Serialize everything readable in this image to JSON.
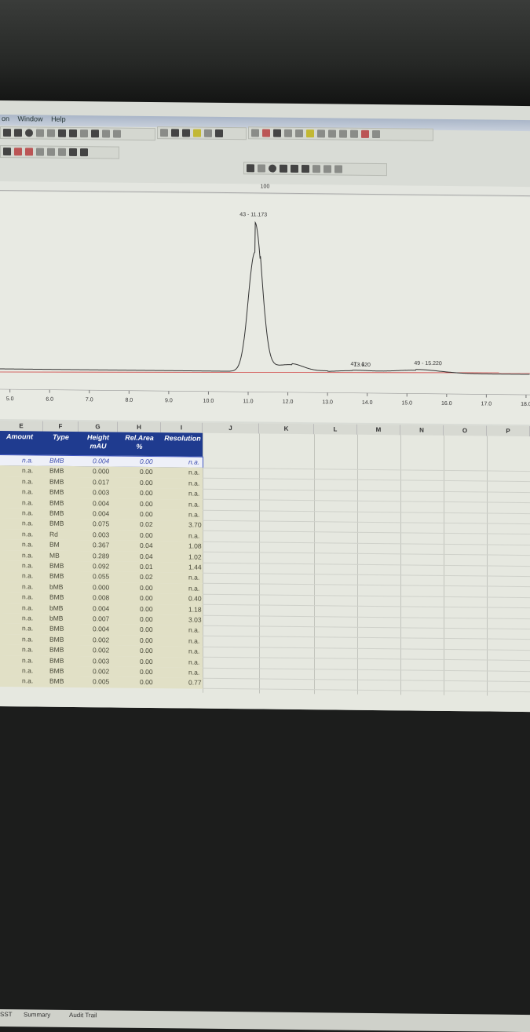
{
  "menu": [
    "on",
    "Window",
    "Help"
  ],
  "ruler_label": "100",
  "chart_data": {
    "type": "line",
    "xlabel": "",
    "ylabel": "",
    "xlim": [
      4.75,
      18.1
    ],
    "ticks": [
      "5.0",
      "6.0",
      "7.0",
      "8.0",
      "9.0",
      "10.0",
      "11.0",
      "12.0",
      "13.0",
      "14.0",
      "15.0",
      "16.0",
      "17.0",
      "18.0"
    ],
    "tick_values": [
      5,
      6,
      7,
      8,
      9,
      10,
      11,
      12,
      13,
      14,
      15,
      16,
      17,
      18
    ],
    "peaks": [
      {
        "rt": 11.173,
        "height": 100,
        "width": 0.17,
        "label": "43 - 11.173"
      },
      {
        "rt": 12.1,
        "height": 4,
        "width": 0.3,
        "label": ""
      },
      {
        "rt": 13.62,
        "height": 1.5,
        "width": 0.5,
        "label": "47 - 1"
      },
      {
        "rt": 15.22,
        "height": 2.5,
        "width": 0.6,
        "label": "49 - 15.220"
      }
    ],
    "extra_labels": [
      "13.620"
    ],
    "baseline_color": "#d04040",
    "trace_color": "#333333"
  },
  "columns": [
    "E",
    "F",
    "G",
    "H",
    "I",
    "J",
    "K",
    "L",
    "M",
    "N",
    "O",
    "P"
  ],
  "headers": {
    "amount": "Amount",
    "type": "Type",
    "height": "Height",
    "height_unit": "mAU",
    "relarea": "Rel.Area",
    "relarea_unit": "%",
    "resolution": "Resolution"
  },
  "rows": [
    [
      "n.a.",
      "BMB",
      "0.004",
      "0.00",
      "n.a."
    ],
    [
      "n.a.",
      "BMB",
      "0.000",
      "0.00",
      "n.a."
    ],
    [
      "n.a.",
      "BMB",
      "0.017",
      "0.00",
      "n.a."
    ],
    [
      "n.a.",
      "BMB",
      "0.003",
      "0.00",
      "n.a."
    ],
    [
      "n.a.",
      "BMB",
      "0.004",
      "0.00",
      "n.a."
    ],
    [
      "n.a.",
      "BMB",
      "0.004",
      "0.00",
      "n.a."
    ],
    [
      "n.a.",
      "BMB",
      "0.075",
      "0.02",
      "3.70"
    ],
    [
      "n.a.",
      "Rd",
      "0.003",
      "0.00",
      "n.a."
    ],
    [
      "n.a.",
      "BM",
      "0.367",
      "0.04",
      "1.08"
    ],
    [
      "n.a.",
      "MB",
      "0.289",
      "0.04",
      "1.02"
    ],
    [
      "n.a.",
      "BMB",
      "0.092",
      "0.01",
      "1.44"
    ],
    [
      "n.a.",
      "BMB",
      "0.055",
      "0.02",
      "n.a."
    ],
    [
      "n.a.",
      "bMB",
      "0.000",
      "0.00",
      "n.a."
    ],
    [
      "n.a.",
      "BMB",
      "0.008",
      "0.00",
      "0.40"
    ],
    [
      "n.a.",
      "bMB",
      "0.004",
      "0.00",
      "1.18"
    ],
    [
      "n.a.",
      "bMB",
      "0.007",
      "0.00",
      "3.03"
    ],
    [
      "n.a.",
      "BMB",
      "0.004",
      "0.00",
      "n.a."
    ],
    [
      "n.a.",
      "BMB",
      "0.002",
      "0.00",
      "n.a."
    ],
    [
      "n.a.",
      "BMB",
      "0.002",
      "0.00",
      "n.a."
    ],
    [
      "n.a.",
      "BMB",
      "0.003",
      "0.00",
      "n.a."
    ],
    [
      "n.a.",
      "BMB",
      "0.002",
      "0.00",
      "n.a."
    ],
    [
      "n.a.",
      "BMB",
      "0.005",
      "0.00",
      "0.77"
    ]
  ],
  "tabs": [
    "SST",
    "Summary",
    "Audit Trail"
  ]
}
